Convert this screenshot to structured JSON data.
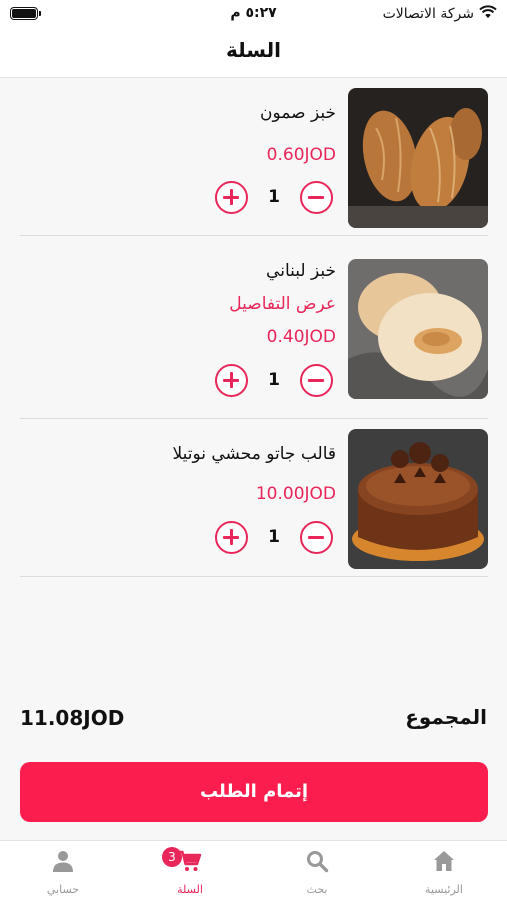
{
  "status_bar": {
    "carrier": "شركة الاتصالات",
    "time": "٥:٢٧ م",
    "wifi_icon": "wifi-icon",
    "battery_icon": "battery-icon"
  },
  "header": {
    "title": "السلة"
  },
  "cart": {
    "items": [
      {
        "name": "خبز صمون",
        "price": "0.60JOD",
        "quantity": "1",
        "details_link": "",
        "image": "samoon-bread-image"
      },
      {
        "name": "خبز لبناني",
        "price": "0.40JOD",
        "quantity": "1",
        "details_link": "عرض التفاصيل",
        "image": "lebanese-bread-image"
      },
      {
        "name": "قالب جاتو محشي نوتيلا",
        "price": "10.00JOD",
        "quantity": "1",
        "details_link": "",
        "image": "nutella-cake-image"
      }
    ],
    "total_label": "المجموع",
    "total_value": "11.08JOD",
    "checkout_label": "إتمام الطلب"
  },
  "tab_bar": {
    "tabs": [
      {
        "label": "الرئيسية",
        "icon": "home-icon"
      },
      {
        "label": "بحث",
        "icon": "search-icon"
      },
      {
        "label": "السلة",
        "icon": "cart-icon",
        "badge": "3",
        "active": true
      },
      {
        "label": "حسابي",
        "icon": "user-icon"
      }
    ]
  },
  "colors": {
    "accent": "#e8265a",
    "checkout": "#fb1d4e",
    "background": "#f7f7f7"
  }
}
